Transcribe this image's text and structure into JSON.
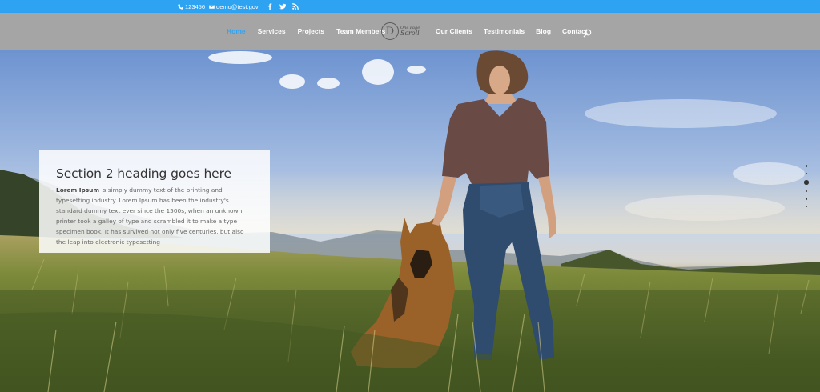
{
  "topbar": {
    "phone": "123456",
    "email": "demo@test.gov",
    "social_icons": [
      "facebook-icon",
      "twitter-icon",
      "rss-icon"
    ]
  },
  "nav": {
    "left": [
      "Home",
      "Services",
      "Projects",
      "Team Members"
    ],
    "right": [
      "Our Clients",
      "Testimonials",
      "Blog",
      "Contact"
    ],
    "active": "Home"
  },
  "logo": {
    "mark": "D",
    "line1": "One Page",
    "line2": "Scroll"
  },
  "section": {
    "heading": "Section 2 heading goes here",
    "body_bold": "Lorem Ipsum",
    "body": " is simply dummy text of the printing and typesetting industry. Lorem Ipsum has been the industry's standard dummy text ever since the 1500s, when an unknown printer took a galley of type and scrambled it to make a type specimen book. It has survived not only five centuries, but also the leap into electronic typesetting"
  },
  "side_nav": {
    "dots": 6,
    "active_index": 2
  },
  "colors": {
    "accent": "#2ea3f2",
    "header_bg": "#a5a5a5"
  }
}
